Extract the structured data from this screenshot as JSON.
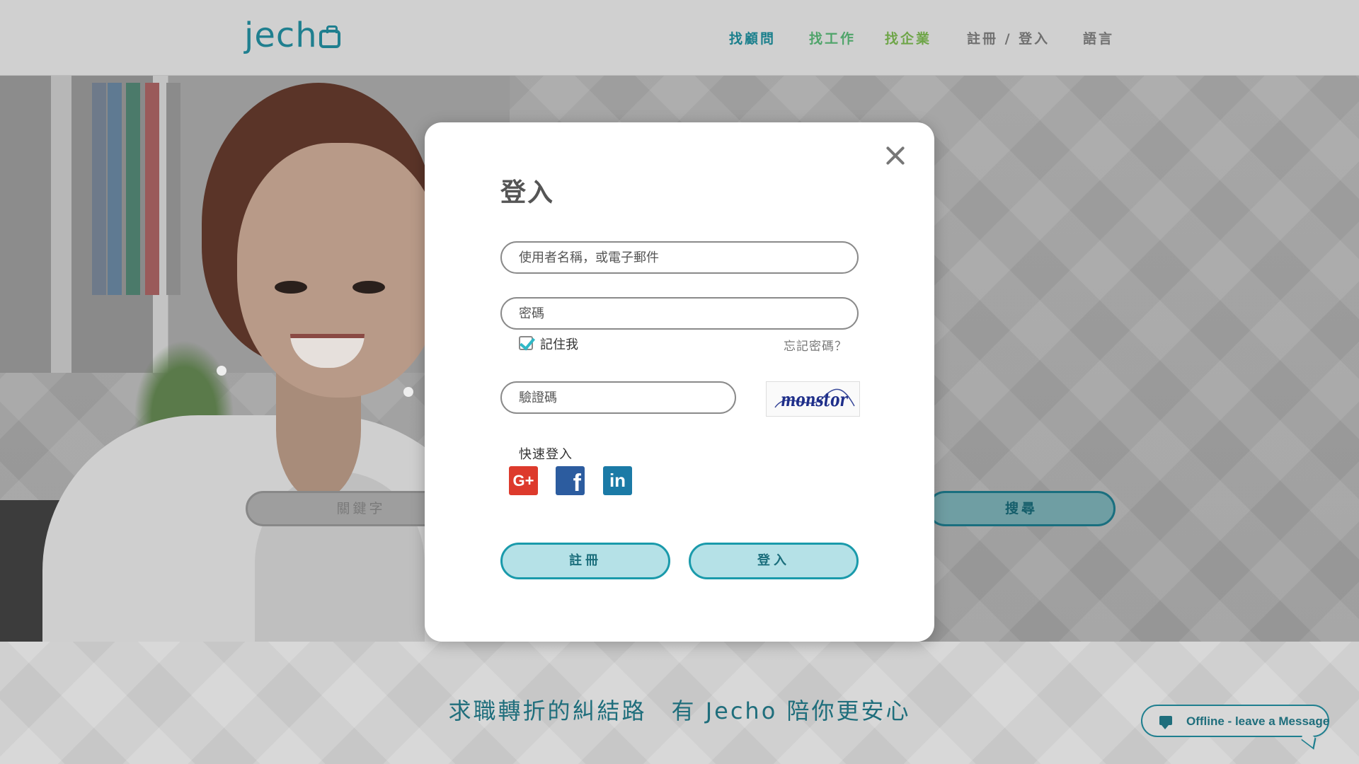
{
  "header": {
    "logo": "jech",
    "nav": [
      {
        "label": "找顧問"
      },
      {
        "label": "找工作"
      },
      {
        "label": "找企業"
      },
      {
        "label": "註冊 / 登入"
      },
      {
        "label": "語言"
      }
    ]
  },
  "hero": {
    "search_placeholder": "關鍵字",
    "search_button": "搜尋"
  },
  "footer_band": {
    "slogan": "求職轉折的糾結路　有 Jecho 陪你更安心",
    "chat_label": "Offline - leave a Message"
  },
  "login_modal": {
    "title": "登入",
    "username_placeholder": "使用者名稱，或電子郵件",
    "password_placeholder": "密碼",
    "remember_label": "記住我",
    "remember_checked": true,
    "forgot_link": "忘記密碼？",
    "captcha_placeholder": "驗證碼",
    "captcha_text": "monstor",
    "quick_login_label": "快速登入",
    "social": [
      {
        "name": "google-plus",
        "glyph": "G+"
      },
      {
        "name": "facebook",
        "glyph": "f"
      },
      {
        "name": "linkedin",
        "glyph": "in"
      }
    ],
    "register_button": "註冊",
    "login_button": "登入"
  },
  "colors": {
    "brand_teal": "#1f7f8f",
    "button_fill": "#b5e1e7",
    "checkbox_check": "#2fb8c6"
  }
}
